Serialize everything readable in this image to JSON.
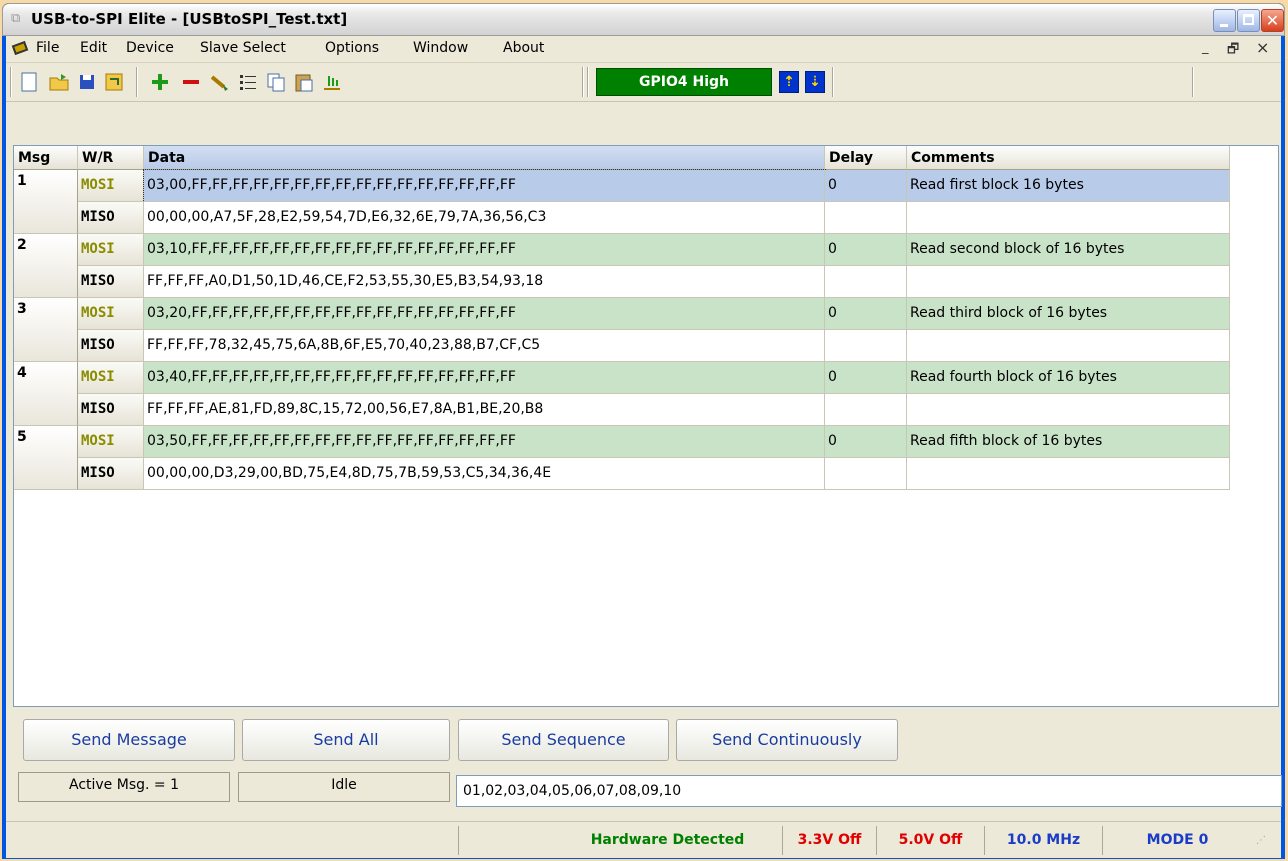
{
  "window": {
    "title": "USB-to-SPI Elite - [USBtoSPI_Test.txt]",
    "close_glyph": "✕"
  },
  "menu": {
    "items": [
      "File",
      "Edit",
      "Device",
      "Slave Select",
      "Options",
      "Window",
      "About"
    ],
    "mdi_min": "_",
    "mdi_restore": "🗗",
    "mdi_close": "×"
  },
  "toolbar": {
    "gpio_label": "GPIO4 High",
    "icons": [
      "new-file-icon",
      "open-folder-icon",
      "save-icon",
      "reload-icon",
      "add-icon",
      "remove-icon",
      "clear-brush-icon",
      "list-icon",
      "copy-icon",
      "paste-icon",
      "export-icon"
    ],
    "edge_rise": "⇡",
    "edge_fall": "⇣"
  },
  "grid": {
    "headers": {
      "msg": "Msg",
      "wr": "W/R",
      "data": "Data",
      "delay": "Delay",
      "comments": "Comments"
    },
    "rows": [
      {
        "msg": "1",
        "mosi": "03,00,FF,FF,FF,FF,FF,FF,FF,FF,FF,FF,FF,FF,FF,FF,FF,FF",
        "miso": "00,00,00,A7,5F,28,E2,59,54,7D,E6,32,6E,79,7A,36,56,C3",
        "delay": "0",
        "comment": "Read first block 16 bytes"
      },
      {
        "msg": "2",
        "mosi": "03,10,FF,FF,FF,FF,FF,FF,FF,FF,FF,FF,FF,FF,FF,FF,FF,FF",
        "miso": "FF,FF,FF,A0,D1,50,1D,46,CE,F2,53,55,30,E5,B3,54,93,18",
        "delay": "0",
        "comment": "Read second block of 16 bytes"
      },
      {
        "msg": "3",
        "mosi": "03,20,FF,FF,FF,FF,FF,FF,FF,FF,FF,FF,FF,FF,FF,FF,FF,FF",
        "miso": "FF,FF,FF,78,32,45,75,6A,8B,6F,E5,70,40,23,88,B7,CF,C5",
        "delay": "0",
        "comment": "Read third block of 16 bytes"
      },
      {
        "msg": "4",
        "mosi": "03,40,FF,FF,FF,FF,FF,FF,FF,FF,FF,FF,FF,FF,FF,FF,FF,FF",
        "miso": "FF,FF,FF,AE,81,FD,89,8C,15,72,00,56,E7,8A,B1,BE,20,B8",
        "delay": "0",
        "comment": "Read fourth block of 16 bytes"
      },
      {
        "msg": "5",
        "mosi": "03,50,FF,FF,FF,FF,FF,FF,FF,FF,FF,FF,FF,FF,FF,FF,FF,FF",
        "miso": "00,00,00,D3,29,00,BD,75,E4,8D,75,7B,59,53,C5,34,36,4E",
        "delay": "0",
        "comment": "Read fifth block of 16 bytes"
      }
    ],
    "mosi_label": "MOSI",
    "miso_label": "MISO"
  },
  "buttons": {
    "send_message": "Send Message",
    "send_all": "Send All",
    "send_sequence": "Send Sequence",
    "send_continuously": "Send Continuously"
  },
  "status": {
    "active_msg": "Active Msg. = 1",
    "state": "Idle",
    "hex_input": "01,02,03,04,05,06,07,08,09,10"
  },
  "statusbar": {
    "hardware": "Hardware Detected",
    "v33": "3.3V Off",
    "v50": "5.0V Off",
    "freq": "10.0 MHz",
    "mode": "MODE 0"
  },
  "colors": {
    "hardware": "#008000",
    "voltage_off": "#e00000",
    "info_blue": "#1a3cc8"
  }
}
